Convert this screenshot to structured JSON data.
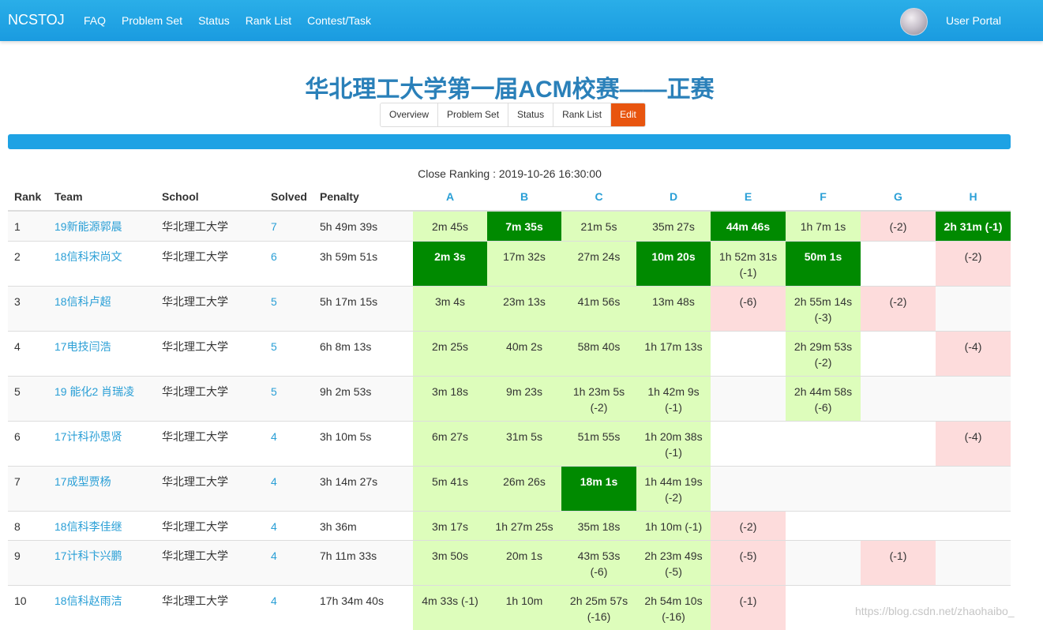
{
  "navbar": {
    "brand": "NCSTOJ",
    "links": [
      "FAQ",
      "Problem Set",
      "Status",
      "Rank List",
      "Contest/Task"
    ],
    "user_portal": "User Portal"
  },
  "contest": {
    "title": "华北理工大学第一届ACM校赛——正赛",
    "tabs": [
      "Overview",
      "Problem Set",
      "Status",
      "Rank List",
      "Edit"
    ],
    "closing_text": "Close Ranking : 2019-10-26 16:30:00"
  },
  "colors": {
    "navbar": "#1ea2e4",
    "accepted": "#ddfdbb",
    "first_blood": "#008a00",
    "wrong": "#fddcdc",
    "edit_button": "#e8550f",
    "link": "#2a9fd6"
  },
  "table": {
    "headers": {
      "rank": "Rank",
      "team": "Team",
      "school": "School",
      "solved": "Solved",
      "penalty": "Penalty",
      "problems": [
        "A",
        "B",
        "C",
        "D",
        "E",
        "F",
        "G",
        "H"
      ]
    },
    "rows": [
      {
        "rank": "1",
        "team": "19新能源郭晨",
        "school": "华北理工大学",
        "solved": "7",
        "penalty": "5h 49m 39s",
        "cells": [
          {
            "status": "ac",
            "text": "2m 45s"
          },
          {
            "status": "fb",
            "text": "7m 35s"
          },
          {
            "status": "ac",
            "text": "21m 5s"
          },
          {
            "status": "ac",
            "text": "35m 27s"
          },
          {
            "status": "fb",
            "text": "44m 46s"
          },
          {
            "status": "ac",
            "text": "1h 7m 1s"
          },
          {
            "status": "wa",
            "text": "(-2)"
          },
          {
            "status": "fb",
            "text": "2h 31m (-1)"
          }
        ]
      },
      {
        "rank": "2",
        "team": "18信科宋尚文",
        "school": "华北理工大学",
        "solved": "6",
        "penalty": "3h 59m 51s",
        "cells": [
          {
            "status": "fb",
            "text": "2m 3s"
          },
          {
            "status": "ac",
            "text": "17m 32s"
          },
          {
            "status": "ac",
            "text": "27m 24s"
          },
          {
            "status": "fb",
            "text": "10m 20s"
          },
          {
            "status": "ac",
            "text": "1h 52m 31s",
            "extra": "(-1)"
          },
          {
            "status": "fb",
            "text": "50m 1s"
          },
          {
            "status": "",
            "text": ""
          },
          {
            "status": "wa",
            "text": "(-2)"
          }
        ]
      },
      {
        "rank": "3",
        "team": "18信科卢超",
        "school": "华北理工大学",
        "solved": "5",
        "penalty": "5h 17m 15s",
        "cells": [
          {
            "status": "ac",
            "text": "3m 4s"
          },
          {
            "status": "ac",
            "text": "23m 13s"
          },
          {
            "status": "ac",
            "text": "41m 56s"
          },
          {
            "status": "ac",
            "text": "13m 48s"
          },
          {
            "status": "wa",
            "text": "(-6)"
          },
          {
            "status": "ac",
            "text": "2h 55m 14s",
            "extra": "(-3)"
          },
          {
            "status": "wa",
            "text": "(-2)"
          },
          {
            "status": "",
            "text": ""
          }
        ]
      },
      {
        "rank": "4",
        "team": "17电技闫浩",
        "school": "华北理工大学",
        "solved": "5",
        "penalty": "6h 8m 13s",
        "cells": [
          {
            "status": "ac",
            "text": "2m 25s"
          },
          {
            "status": "ac",
            "text": "40m 2s"
          },
          {
            "status": "ac",
            "text": "58m 40s"
          },
          {
            "status": "ac",
            "text": "1h 17m 13s"
          },
          {
            "status": "",
            "text": ""
          },
          {
            "status": "ac",
            "text": "2h 29m 53s",
            "extra": "(-2)"
          },
          {
            "status": "",
            "text": ""
          },
          {
            "status": "wa",
            "text": "(-4)"
          }
        ]
      },
      {
        "rank": "5",
        "team": "19 能化2 肖瑞凌",
        "school": "华北理工大学",
        "solved": "5",
        "penalty": "9h 2m 53s",
        "cells": [
          {
            "status": "ac",
            "text": "3m 18s"
          },
          {
            "status": "ac",
            "text": "9m 23s"
          },
          {
            "status": "ac",
            "text": "1h 23m 5s",
            "extra": "(-2)"
          },
          {
            "status": "ac",
            "text": "1h 42m 9s",
            "extra": "(-1)"
          },
          {
            "status": "",
            "text": ""
          },
          {
            "status": "ac",
            "text": "2h 44m 58s",
            "extra": "(-6)"
          },
          {
            "status": "",
            "text": ""
          },
          {
            "status": "",
            "text": ""
          }
        ]
      },
      {
        "rank": "6",
        "team": "17计科孙思贤",
        "school": "华北理工大学",
        "solved": "4",
        "penalty": "3h 10m 5s",
        "cells": [
          {
            "status": "ac",
            "text": "6m 27s"
          },
          {
            "status": "ac",
            "text": "31m 5s"
          },
          {
            "status": "ac",
            "text": "51m 55s"
          },
          {
            "status": "ac",
            "text": "1h 20m 38s",
            "extra": "(-1)"
          },
          {
            "status": "",
            "text": ""
          },
          {
            "status": "",
            "text": ""
          },
          {
            "status": "",
            "text": ""
          },
          {
            "status": "wa",
            "text": "(-4)"
          }
        ]
      },
      {
        "rank": "7",
        "team": "17成型贾杨",
        "school": "华北理工大学",
        "solved": "4",
        "penalty": "3h 14m 27s",
        "cells": [
          {
            "status": "ac",
            "text": "5m 41s"
          },
          {
            "status": "ac",
            "text": "26m 26s"
          },
          {
            "status": "fb",
            "text": "18m 1s"
          },
          {
            "status": "ac",
            "text": "1h 44m 19s",
            "extra": "(-2)"
          },
          {
            "status": "",
            "text": ""
          },
          {
            "status": "",
            "text": ""
          },
          {
            "status": "",
            "text": ""
          },
          {
            "status": "",
            "text": ""
          }
        ]
      },
      {
        "rank": "8",
        "team": "18信科李佳继",
        "school": "华北理工大学",
        "solved": "4",
        "penalty": "3h 36m",
        "cells": [
          {
            "status": "ac",
            "text": "3m 17s"
          },
          {
            "status": "ac",
            "text": "1h 27m 25s"
          },
          {
            "status": "ac",
            "text": "35m 18s"
          },
          {
            "status": "ac",
            "text": "1h 10m (-1)"
          },
          {
            "status": "wa",
            "text": "(-2)"
          },
          {
            "status": "",
            "text": ""
          },
          {
            "status": "",
            "text": ""
          },
          {
            "status": "",
            "text": ""
          }
        ]
      },
      {
        "rank": "9",
        "team": "17计科卞兴鹏",
        "school": "华北理工大学",
        "solved": "4",
        "penalty": "7h 11m 33s",
        "cells": [
          {
            "status": "ac",
            "text": "3m 50s"
          },
          {
            "status": "ac",
            "text": "20m 1s"
          },
          {
            "status": "ac",
            "text": "43m 53s",
            "extra": "(-6)"
          },
          {
            "status": "ac",
            "text": "2h 23m 49s",
            "extra": "(-5)"
          },
          {
            "status": "wa",
            "text": "(-5)"
          },
          {
            "status": "",
            "text": ""
          },
          {
            "status": "wa",
            "text": "(-1)"
          },
          {
            "status": "",
            "text": ""
          }
        ]
      },
      {
        "rank": "10",
        "team": "18信科赵雨洁",
        "school": "华北理工大学",
        "solved": "4",
        "penalty": "17h 34m 40s",
        "cells": [
          {
            "status": "ac",
            "text": "4m 33s (-1)"
          },
          {
            "status": "ac",
            "text": "1h 10m"
          },
          {
            "status": "ac",
            "text": "2h 25m 57s",
            "extra": "(-16)"
          },
          {
            "status": "ac",
            "text": "2h 54m 10s",
            "extra": "(-16)"
          },
          {
            "status": "wa",
            "text": "(-1)"
          },
          {
            "status": "",
            "text": ""
          },
          {
            "status": "",
            "text": ""
          },
          {
            "status": "",
            "text": ""
          }
        ]
      }
    ]
  },
  "watermark": "https://blog.csdn.net/zhaohaibo_"
}
